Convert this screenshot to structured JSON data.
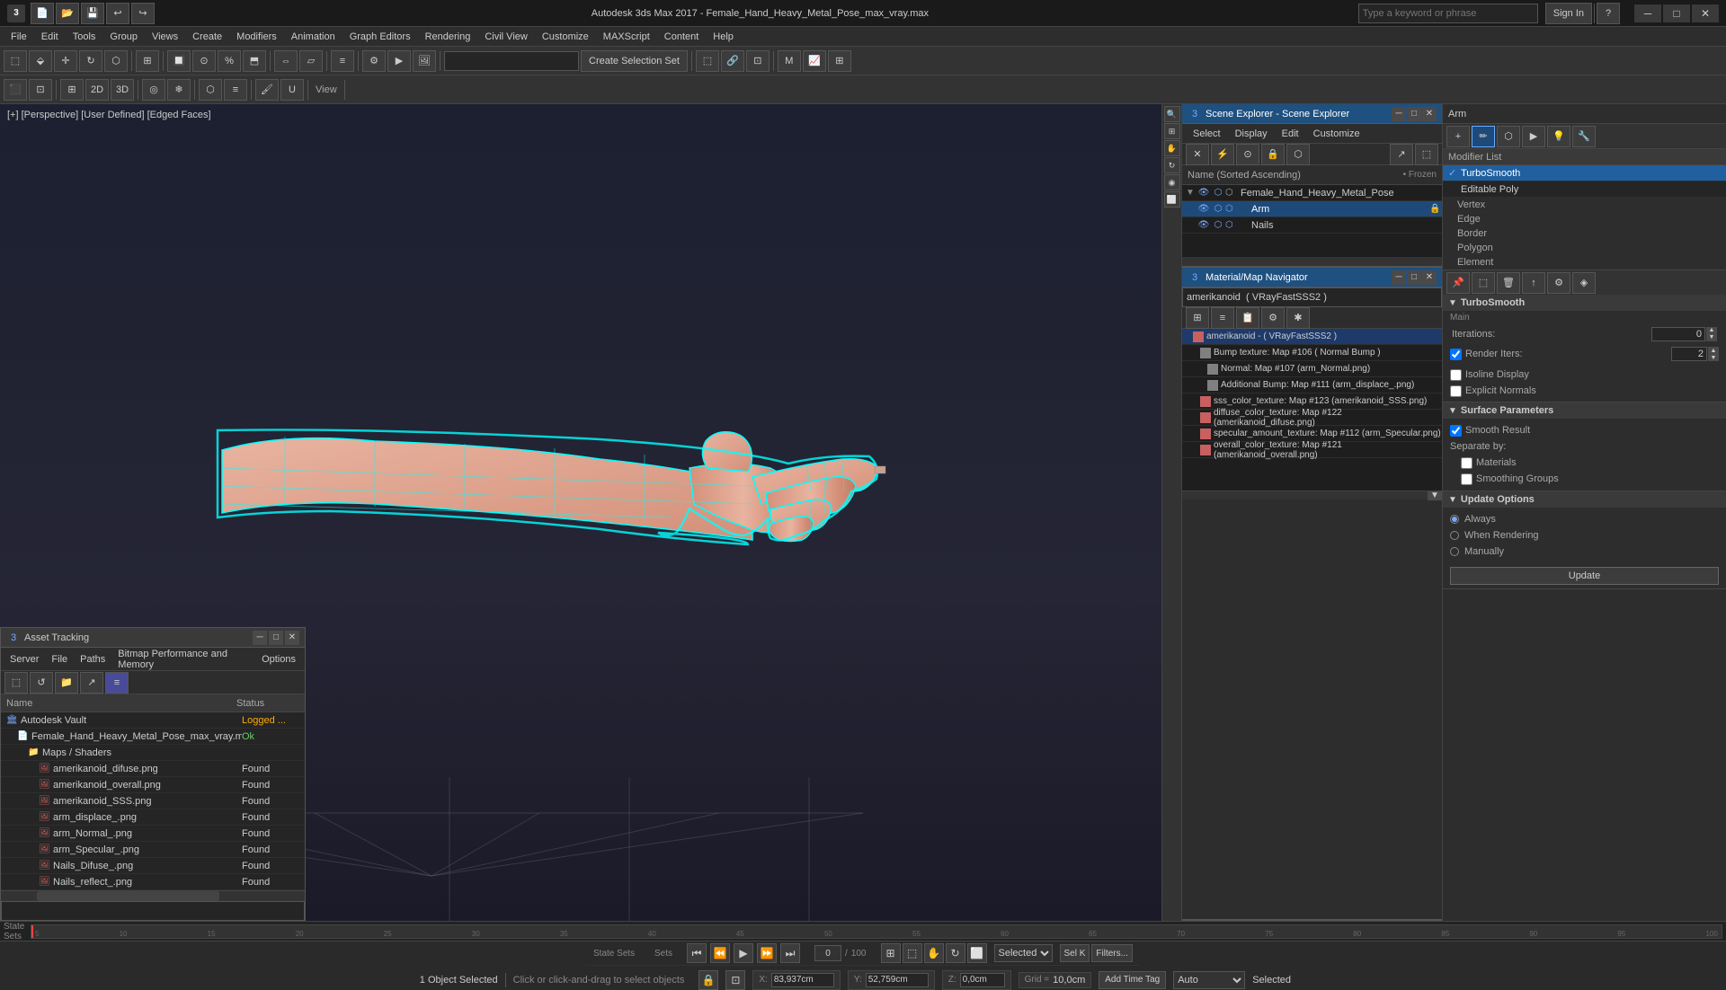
{
  "titlebar": {
    "icon": "3",
    "title": "Autodesk 3ds Max 2017  -  Female_Hand_Heavy_Metal_Pose_max_vray.max",
    "search_placeholder": "Type a keyword or phrase",
    "sign_in": "Sign In"
  },
  "menu": {
    "items": [
      "File",
      "Edit",
      "Tools",
      "Group",
      "Views",
      "Create",
      "Modifiers",
      "Animation",
      "Graph Editors",
      "Rendering",
      "Civil View",
      "Customize",
      "MAXScript",
      "Content",
      "Help"
    ]
  },
  "civil_view_tab": "Civil View",
  "toolbar1": {
    "selection_set_btn": "Create Selection Set",
    "selection_set_value": ""
  },
  "viewport": {
    "label": "[+] [Perspective]  [User Defined]  [Edged Faces]"
  },
  "asset_panel": {
    "title": "Asset Tracking",
    "menu_items": [
      "Server",
      "File",
      "Paths",
      "Bitmap Performance and Memory",
      "Options"
    ],
    "columns": [
      "Name",
      "Status"
    ],
    "items": [
      {
        "indent": 0,
        "icon": "vault",
        "name": "Autodesk Vault",
        "status": "Logged ...",
        "type": "vault"
      },
      {
        "indent": 1,
        "icon": "file",
        "name": "Female_Hand_Heavy_Metal_Pose_max_vray.max",
        "status": "Ok",
        "type": "file"
      },
      {
        "indent": 2,
        "icon": "folder",
        "name": "Maps / Shaders",
        "status": "",
        "type": "folder"
      },
      {
        "indent": 3,
        "icon": "map",
        "name": "amerikanoid_difuse.png",
        "status": "Found",
        "type": "map"
      },
      {
        "indent": 3,
        "icon": "map",
        "name": "amerikanoid_overall.png",
        "status": "Found",
        "type": "map"
      },
      {
        "indent": 3,
        "icon": "map",
        "name": "amerikanoid_SSS.png",
        "status": "Found",
        "type": "map"
      },
      {
        "indent": 3,
        "icon": "map",
        "name": "arm_displace_.png",
        "status": "Found",
        "type": "map"
      },
      {
        "indent": 3,
        "icon": "map",
        "name": "arm_Normal_.png",
        "status": "Found",
        "type": "map"
      },
      {
        "indent": 3,
        "icon": "map",
        "name": "arm_Specular_.png",
        "status": "Found",
        "type": "map"
      },
      {
        "indent": 3,
        "icon": "map",
        "name": "Nails_Difuse_.png",
        "status": "Found",
        "type": "map"
      },
      {
        "indent": 3,
        "icon": "map",
        "name": "Nails_reflect_.png",
        "status": "Found",
        "type": "map"
      }
    ]
  },
  "scene_explorer": {
    "title": "Scene Explorer - Scene Explorer",
    "menu_items": [
      "Select",
      "Display",
      "Edit",
      "Customize"
    ],
    "filter_label": "Name (Sorted Ascending)",
    "frozen_label": "• Frozen",
    "items": [
      {
        "indent": 0,
        "name": "Female_Hand_Heavy_Metal_Pose",
        "type": "root",
        "selected": false
      },
      {
        "indent": 1,
        "name": "Arm",
        "type": "object",
        "selected": true
      },
      {
        "indent": 1,
        "name": "Nails",
        "type": "object",
        "selected": false
      }
    ]
  },
  "modifier_panel": {
    "title": "Arm",
    "modifier_list_label": "Modifier List",
    "modifiers": [
      {
        "name": "TurboSmooth",
        "active": true
      },
      {
        "name": "Editable Poly",
        "active": false
      }
    ],
    "sub_objects": [
      {
        "name": "Vertex"
      },
      {
        "name": "Edge"
      },
      {
        "name": "Border"
      },
      {
        "name": "Polygon"
      },
      {
        "name": "Element"
      }
    ],
    "turbosmooth": {
      "label": "TurboSmooth",
      "main_label": "Main",
      "iterations_label": "Iterations:",
      "iterations_value": "0",
      "render_iters_label": "Render Iters:",
      "render_iters_value": "2",
      "isoline_display_label": "Isoline Display",
      "explicit_normals_label": "Explicit Normals"
    },
    "surface_params": {
      "section_label": "Surface Parameters",
      "smooth_result_label": "Smooth Result",
      "separate_by_label": "Separate by:",
      "materials_label": "Materials",
      "smoothing_groups_label": "Smoothing Groups"
    },
    "update_options": {
      "section_label": "Update Options",
      "always_label": "Always",
      "when_rendering_label": "When Rendering",
      "manually_label": "Manually",
      "update_btn_label": "Update"
    }
  },
  "mat_navigator": {
    "title": "Material/Map Navigator",
    "name_value": "amerikanoid  ( VRayFastSSS2 )",
    "items": [
      {
        "name": "amerikanoid - ( VRayFastSSS2 )",
        "color": "#c86060",
        "selected": true
      },
      {
        "name": "Bump texture: Map #106 ( Normal Bump )",
        "color": "#808080",
        "indent": 1
      },
      {
        "name": "Normal: Map #107 (arm_Normal.png)",
        "color": "#808080",
        "indent": 2
      },
      {
        "name": "Additional Bump: Map #111 (arm_displace_.png)",
        "color": "#808080",
        "indent": 2
      },
      {
        "name": "sss_color_texture: Map #123 (amerikanoid_SSS.png)",
        "color": "#c86060",
        "indent": 1
      },
      {
        "name": "diffuse_color_texture: Map #122 (amerikanoid_difuse.png)",
        "color": "#c86060",
        "indent": 1
      },
      {
        "name": "specular_amount_texture: Map #112 (arm_Specular.png)",
        "color": "#c86060",
        "indent": 1
      },
      {
        "name": "overall_color_texture: Map #121 (amerikanoid_overall.png)",
        "color": "#c86060",
        "indent": 1
      }
    ]
  },
  "status_bar": {
    "object_selected": "1 Object Selected",
    "hint": "Click or click-and-drag to select objects",
    "x_label": "X:",
    "x_value": "83,937cm",
    "y_label": "Y:",
    "y_value": "52,759cm",
    "z_label": "Z:",
    "z_value": "0,0cm",
    "grid_label": "Grid =",
    "grid_value": "10,0cm",
    "time_label": "Add Time Tag",
    "selection_label": "Selected"
  },
  "timeline": {
    "frame_current": "0",
    "frame_total": "100",
    "ticks": [
      "5",
      "10",
      "15",
      "20",
      "25",
      "30",
      "35",
      "40",
      "45",
      "50",
      "55",
      "60",
      "65",
      "70",
      "75",
      "80",
      "85",
      "90",
      "95",
      "100"
    ]
  },
  "state_sets": "State Sets",
  "sets_label": "Sets"
}
